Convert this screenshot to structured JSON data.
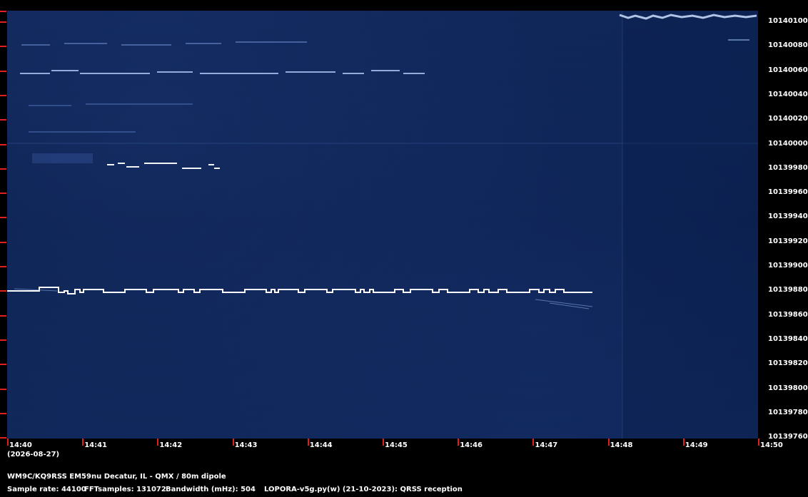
{
  "spectrogram": {
    "background_color": "#0c2150",
    "signal_color": "#ffffff"
  },
  "y_axis": {
    "labels": [
      "10140100",
      "10140080",
      "10140060",
      "10140040",
      "10140020",
      "10140000",
      "10139980",
      "10139960",
      "10139940",
      "10139920",
      "10139900",
      "10139880",
      "10139860",
      "10139840",
      "10139820",
      "10139800",
      "10139780",
      "10139760"
    ]
  },
  "x_axis": {
    "labels": [
      "14:40",
      "14:41",
      "14:42",
      "14:43",
      "14:44",
      "14:45",
      "14:46",
      "14:47",
      "14:48",
      "14:49",
      "14:50"
    ],
    "date": "(2026-08-27)"
  },
  "footer": {
    "station": "WM9C/KQ9RSS EM59nu Decatur, IL - QMX / 80m dipole",
    "sample_rate": "Sample rate: 44100",
    "fft_samples": "FFTsamples: 131072",
    "bandwidth": "Bandwidth (mHz): 504",
    "software": "LOPORA-v5g.py(w) (21-10-2023): QRSS reception"
  }
}
